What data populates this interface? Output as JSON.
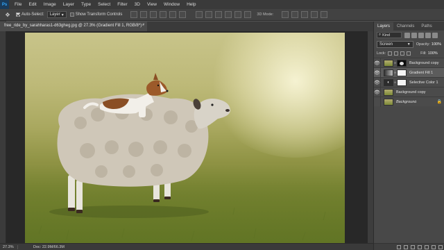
{
  "menu": [
    "File",
    "Edit",
    "Image",
    "Layer",
    "Type",
    "Select",
    "Filter",
    "3D",
    "View",
    "Window",
    "Help"
  ],
  "logo_text": "Ps",
  "options": {
    "auto_select_label": "Auto-Select:",
    "auto_select_target": "Layer",
    "show_transform_label": "Show Transform Controls",
    "mode_label": "3D Mode:"
  },
  "document": {
    "tab_title": "free_ride_by_sarahharas1-d63gheg.jpg @ 27.3% (Gradient Fill 1, RGB/8*) *",
    "close_glyph": "×"
  },
  "status": {
    "zoom": "27.3%",
    "doc": "Doc: 22.9M/66.3M"
  },
  "panel": {
    "tabs": [
      "Layers",
      "Channels",
      "Paths"
    ],
    "active_tab": "Layers",
    "kind_label": "Kind",
    "blend_mode": "Screen",
    "opacity_label": "Opacity:",
    "opacity_value": "100%",
    "lock_label": "Lock:",
    "fill_label": "Fill:",
    "fill_value": "100%",
    "layers": [
      {
        "name": "Background copy",
        "visible": true,
        "thumb": "photo",
        "mask": "black",
        "selected": false
      },
      {
        "name": "Gradient Fill 1",
        "visible": true,
        "thumb": "grad",
        "mask": "white",
        "selected": true
      },
      {
        "name": "Selective Color 1",
        "visible": true,
        "thumb": "adj",
        "mask": "white",
        "selected": false
      },
      {
        "name": "Background copy",
        "visible": true,
        "thumb": "photo",
        "mask": "",
        "selected": false
      },
      {
        "name": "Background",
        "visible": false,
        "thumb": "photo",
        "mask": "",
        "selected": false,
        "locked": true
      }
    ]
  },
  "colors": {
    "menubar": "#3a3a3a",
    "panel": "#484848",
    "accent": "#31a8ff"
  }
}
